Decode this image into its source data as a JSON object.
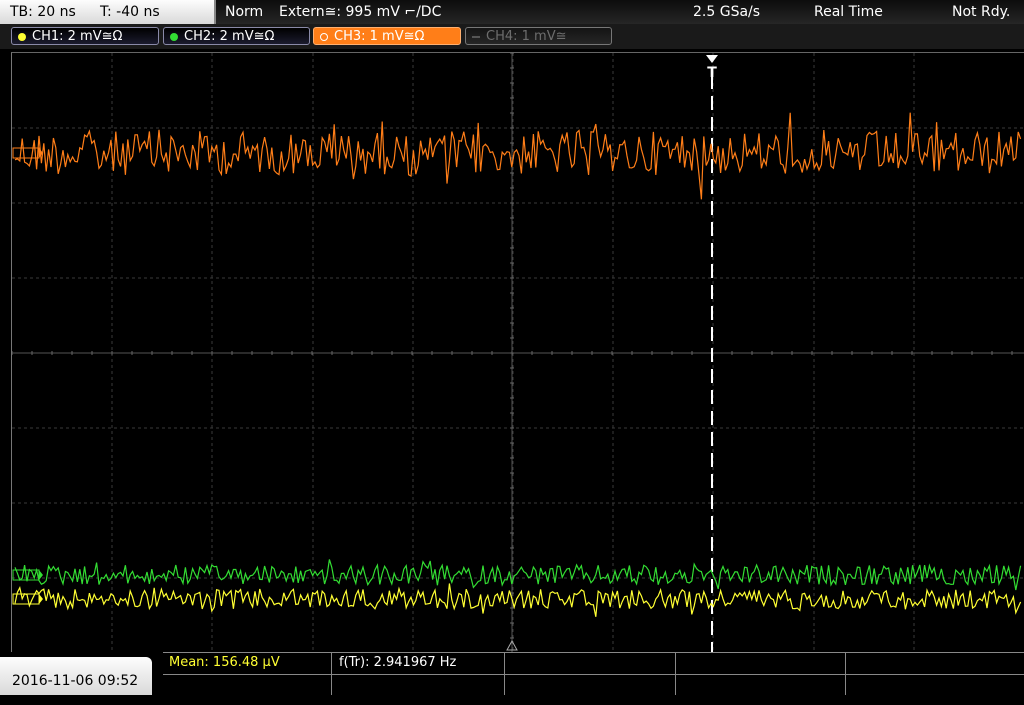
{
  "topbar": {
    "timebase": "TB: 20 ns",
    "trigger_time": "T: -40 ns",
    "trigger_mode": "Norm",
    "trigger_source": "Extern≅: 995 mV ⌐/DC",
    "sample_rate": "2.5 GSa/s",
    "acq_mode": "Real Time",
    "status": "Not Rdy."
  },
  "channels": [
    {
      "label": "CH1: 2 mV≅Ω",
      "color": "#ffff33",
      "state": "on"
    },
    {
      "label": "CH2: 2 mV≅Ω",
      "color": "#33dd33",
      "state": "on"
    },
    {
      "label": "CH3: 1 mV≅Ω",
      "color": "#ff7e18",
      "state": "active"
    },
    {
      "label": "CH4: 1 mV≅",
      "color": "#6d6d6d",
      "state": "off"
    }
  ],
  "trigger_marker": "T",
  "bottombar": {
    "datetime": "2016-11-06 09:52",
    "mean": "Mean: 156.48 µV",
    "frequency": "f(Tr): 2.941967 Hz"
  },
  "colors": {
    "ch1": "#ffff33",
    "ch2": "#33dd33",
    "ch3": "#ff7e18",
    "grid": "#3a3a3a"
  }
}
